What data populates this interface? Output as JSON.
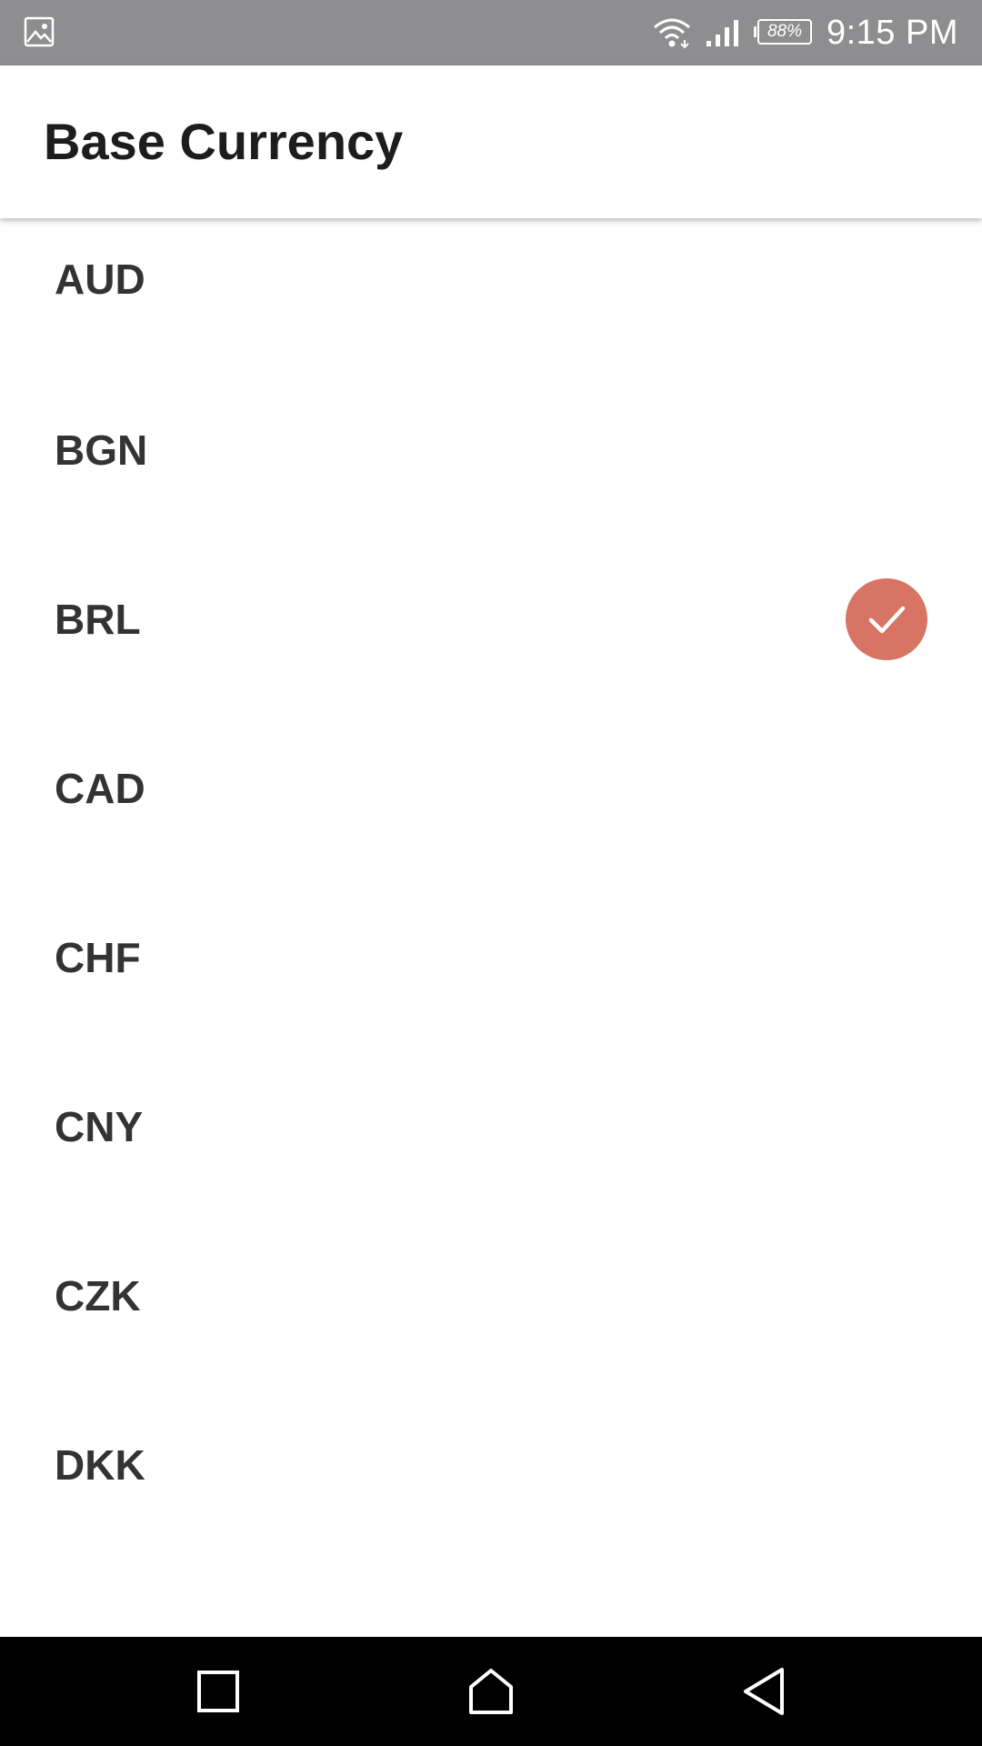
{
  "status_bar": {
    "battery_percent": "88%",
    "time": "9:15 PM",
    "icons": [
      "gallery-icon",
      "wifi-icon",
      "signal-icon",
      "battery-icon"
    ]
  },
  "app_bar": {
    "title": "Base Currency"
  },
  "currencies": [
    {
      "code": "AUD",
      "selected": false
    },
    {
      "code": "BGN",
      "selected": false
    },
    {
      "code": "BRL",
      "selected": true
    },
    {
      "code": "CAD",
      "selected": false
    },
    {
      "code": "CHF",
      "selected": false
    },
    {
      "code": "CNY",
      "selected": false
    },
    {
      "code": "CZK",
      "selected": false
    },
    {
      "code": "DKK",
      "selected": false
    }
  ],
  "colors": {
    "status_bar": "#8e8e90",
    "selected_badge": "#d87463",
    "text": "#333333",
    "nav_bar": "#000000"
  },
  "nav_bar": {
    "icons": [
      "recents-icon",
      "home-icon",
      "back-icon"
    ]
  }
}
